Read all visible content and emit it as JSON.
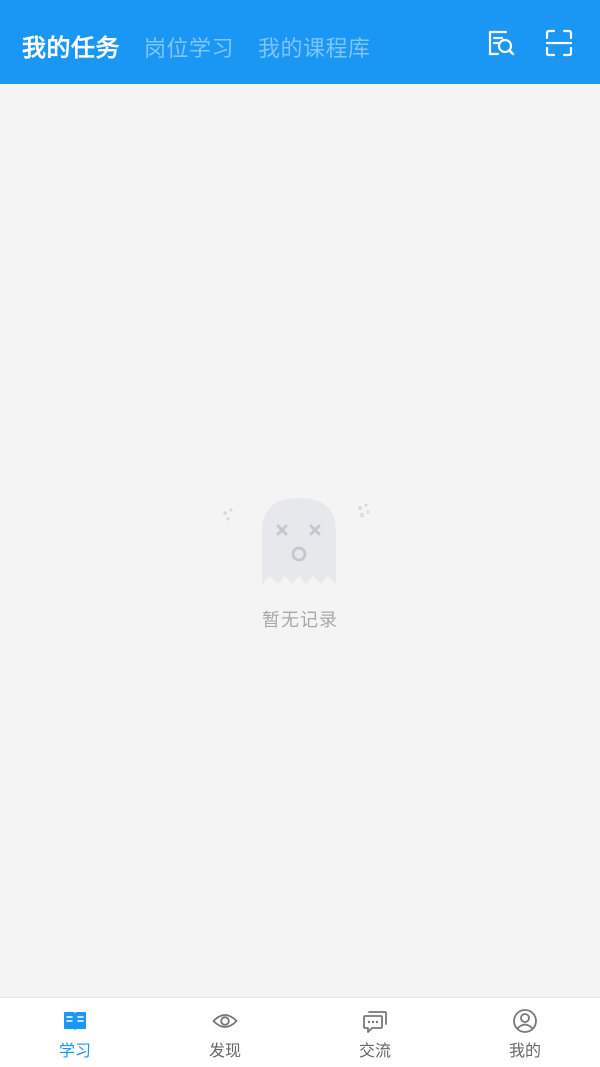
{
  "header": {
    "tabs": [
      {
        "label": "我的任务",
        "active": true
      },
      {
        "label": "岗位学习",
        "active": false
      },
      {
        "label": "我的课程库",
        "active": false
      }
    ],
    "icons": [
      "search-document-icon",
      "scan-icon"
    ],
    "color": "#1a96f5"
  },
  "empty_state": {
    "icon": "ghost-icon",
    "text": "暂无记录"
  },
  "tabbar": {
    "items": [
      {
        "label": "学习",
        "icon": "book-icon",
        "active": true
      },
      {
        "label": "发现",
        "icon": "eye-icon",
        "active": false
      },
      {
        "label": "交流",
        "icon": "chat-icon",
        "active": false
      },
      {
        "label": "我的",
        "icon": "user-icon",
        "active": false
      }
    ],
    "active_color": "#1a96f5",
    "inactive_color": "#666666"
  }
}
